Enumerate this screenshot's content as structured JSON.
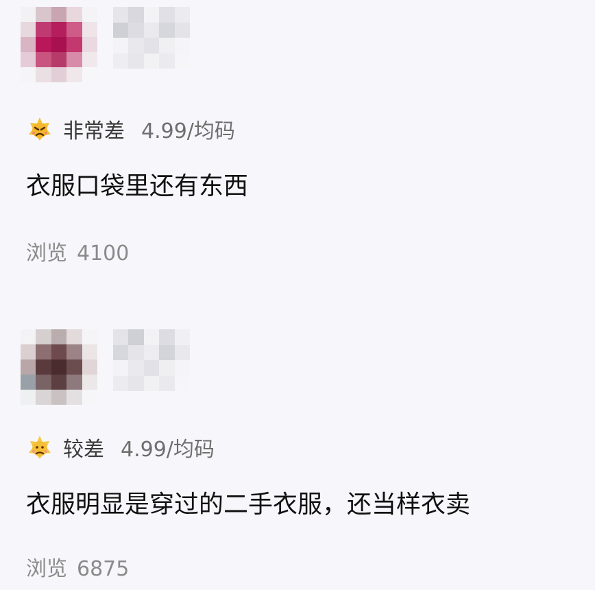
{
  "reviews": [
    {
      "rating_label": "非常差",
      "variant": "4.99/均码",
      "comment": "衣服口袋里还有东西",
      "views_label": "浏览",
      "views_count": "4100",
      "rating_icon": "angry-face-icon"
    },
    {
      "rating_label": "较差",
      "variant": "4.99/均码",
      "comment": "衣服明显是穿过的二手衣服，还当样衣卖",
      "views_label": "浏览",
      "views_count": "6875",
      "rating_icon": "unhappy-face-icon"
    }
  ]
}
